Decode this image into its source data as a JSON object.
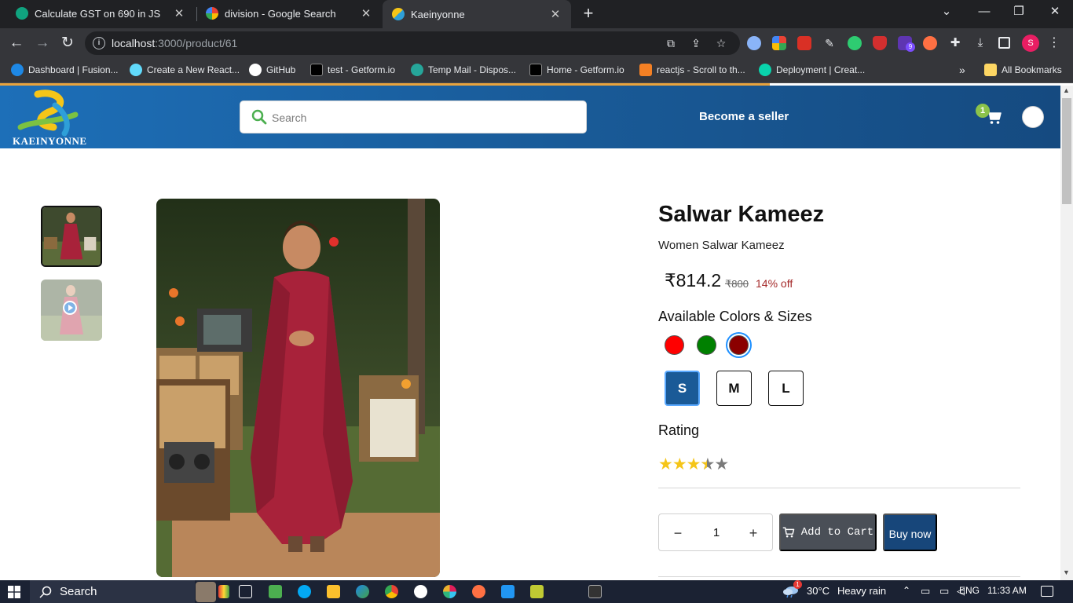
{
  "browser": {
    "tabs": [
      {
        "title": "Calculate GST on 690 in JS",
        "favicon": "chatgpt-icon",
        "active": false
      },
      {
        "title": "division - Google Search",
        "favicon": "google-icon",
        "active": false
      },
      {
        "title": "Kaeinyonne",
        "favicon": "kaeinyonne-icon",
        "active": true
      }
    ],
    "new_tab": "+",
    "url_host": "localhost",
    "url_path": ":3000/product/61",
    "profile_initial": "S",
    "extension_badge": "9"
  },
  "bookmarks": {
    "items": [
      {
        "label": "Dashboard | Fusion..."
      },
      {
        "label": "Create a New React..."
      },
      {
        "label": "GitHub"
      },
      {
        "label": "test - Getform.io"
      },
      {
        "label": "Temp Mail - Dispos..."
      },
      {
        "label": "Home - Getform.io"
      },
      {
        "label": "reactjs - Scroll to th..."
      },
      {
        "label": "Deployment | Creat..."
      }
    ],
    "more": "»",
    "all_bookmarks": "All Bookmarks"
  },
  "site": {
    "logo_text": "KAEINYONNE",
    "search_placeholder": "Search",
    "seller_link": "Become a seller",
    "cart_count": "1",
    "brand_color": "#195a97"
  },
  "product": {
    "title": "Salwar Kameez",
    "subtitle": "Women Salwar Kameez",
    "price": "₹814.2",
    "mrp": "₹800",
    "discount": "14% off",
    "available_heading": "Available Colors & Sizes",
    "colors": [
      "#ff0000",
      "#008000",
      "#8b0000"
    ],
    "selected_color_index": 2,
    "sizes": [
      "S",
      "M",
      "L"
    ],
    "selected_size": "S",
    "rating_heading": "Rating",
    "rating_value": 3.5,
    "rating_max": 5,
    "quantity": "1",
    "add_to_cart": "Add to Cart",
    "buy_now": "Buy now"
  },
  "taskbar": {
    "search_label": "Search",
    "temperature": "30°C",
    "weather": "Heavy rain",
    "weather_badge": "1",
    "language": "ENG",
    "time": "11:33 AM"
  }
}
